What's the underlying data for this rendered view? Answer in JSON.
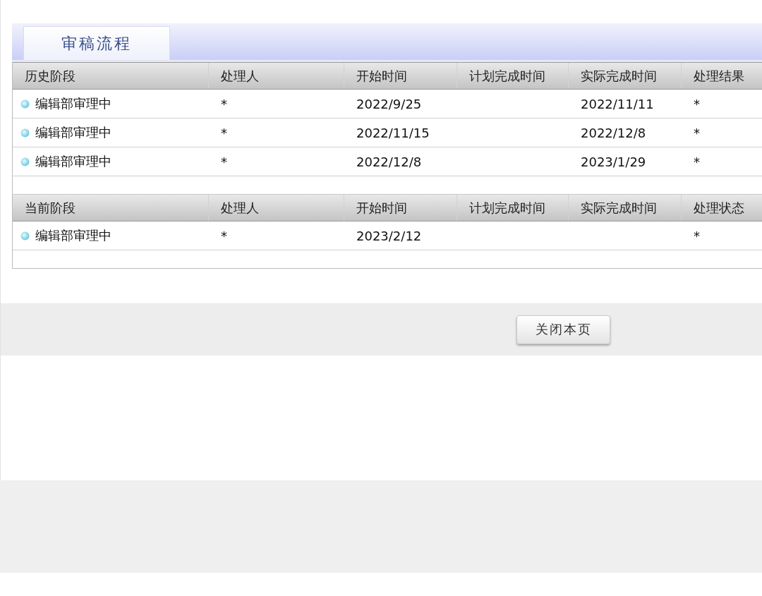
{
  "tab": {
    "label": "审稿流程",
    "selected": true
  },
  "history": {
    "columns": [
      "历史阶段",
      "处理人",
      "开始时间",
      "计划完成时间",
      "实际完成时间",
      "处理结果"
    ],
    "rows": [
      [
        "编辑部审理中",
        "*",
        "2022/9/25",
        null,
        "2022/11/11",
        "*"
      ],
      [
        "编辑部审理中",
        "*",
        "2022/11/15",
        null,
        "2022/12/8",
        "*"
      ],
      [
        "编辑部审理中",
        "*",
        "2022/12/8",
        null,
        "2023/1/29",
        "*"
      ]
    ]
  },
  "current": {
    "columns": [
      "当前阶段",
      "处理人",
      "开始时间",
      "计划完成时间",
      "实际完成时间",
      "处理状态"
    ],
    "rows": [
      [
        "编辑部审理中",
        "*",
        "2023/2/12",
        null,
        null,
        "*"
      ]
    ]
  },
  "close_button": "关闭本页"
}
